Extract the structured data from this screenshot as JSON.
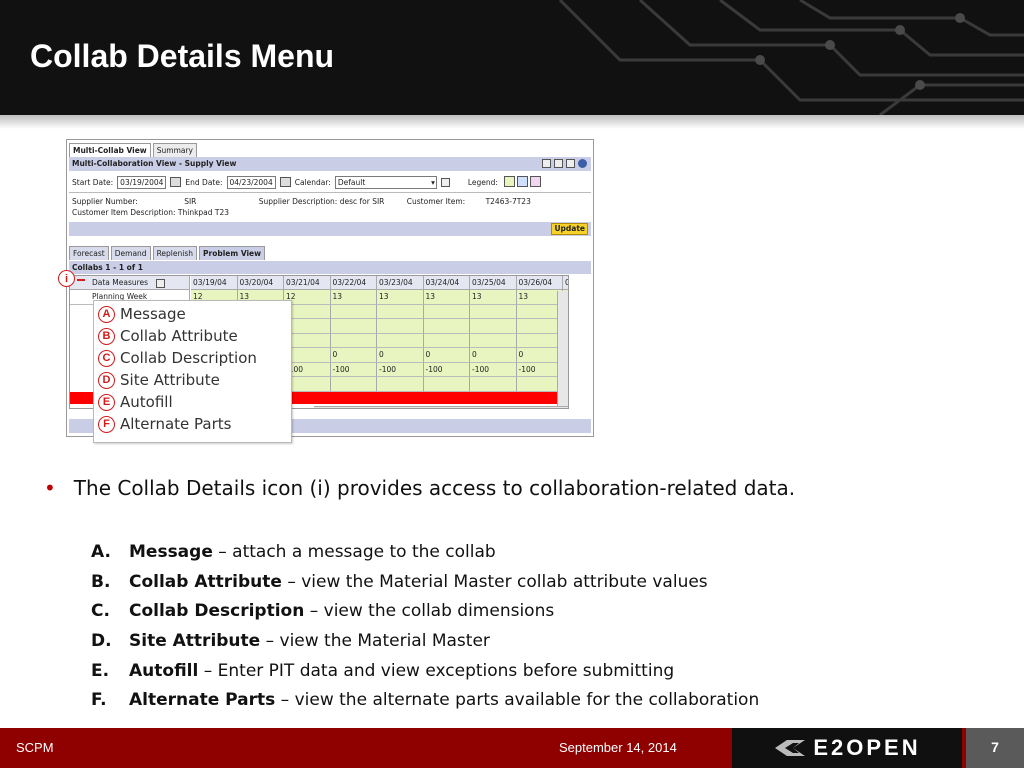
{
  "slide": {
    "title": "Collab Details Menu",
    "bullet": "The Collab Details icon (i) provides access to collaboration-related data.",
    "definitions": [
      {
        "letter": "A.",
        "term": "Message",
        "desc": " – attach a message to the collab"
      },
      {
        "letter": "B.",
        "term": "Collab Attribute",
        "desc": " – view the Material Master collab attribute values"
      },
      {
        "letter": "C.",
        "term": "Collab Description",
        "desc": " – view the collab dimensions"
      },
      {
        "letter": "D.",
        "term": "Site Attribute",
        "desc": " – view the Material Master"
      },
      {
        "letter": "E.",
        "term": "Autofill",
        "desc": " – Enter PIT data and view exceptions before submitting"
      },
      {
        "letter": "F.",
        "term": "Alternate Parts",
        "desc": " – view the alternate parts available for the collaboration"
      }
    ]
  },
  "screenshot": {
    "tabs_top": [
      "Multi-Collab View",
      "Summary"
    ],
    "view_title": "Multi-Collaboration View - Supply View",
    "start_date_label": "Start Date:",
    "start_date": "03/19/2004",
    "end_date_label": "End Date:",
    "end_date": "04/23/2004",
    "calendar_label": "Calendar:",
    "calendar_value": "Default",
    "legend_label": "Legend:",
    "supplier_number_label": "Supplier Number:",
    "supplier_number": "SIR",
    "supplier_desc_label": "Supplier Description:",
    "supplier_desc": "desc for SIR",
    "customer_item_label": "Customer Item:",
    "customer_item": "T2463-7T23",
    "customer_item_desc": "Customer Item Description: Thinkpad T23",
    "update_label": "Update",
    "tabs_view": [
      "Forecast",
      "Demand",
      "Replenish",
      "Problem View"
    ],
    "collabs_label": "Collabs 1 - 1 of 1",
    "grid": {
      "measure_header": "Data Measures",
      "first_row_label": "Planning Week",
      "dates": [
        "03/19/04",
        "03/20/04",
        "03/21/04",
        "03/22/04",
        "03/23/04",
        "03/24/04",
        "03/25/04",
        "03/26/04",
        "0"
      ],
      "row_planning": [
        "12",
        "13",
        "12",
        "13",
        "13",
        "13",
        "13",
        "13",
        "1"
      ],
      "row_zero": [
        "0",
        "0",
        "0",
        "0",
        "0",
        "0",
        "0"
      ],
      "row_neg": [
        "-100",
        "-100",
        "-100",
        "-100",
        "-100",
        "-100",
        "-:"
      ]
    },
    "marker_i": "i",
    "menu": [
      {
        "key": "A",
        "label": "Message"
      },
      {
        "key": "B",
        "label": "Collab Attribute"
      },
      {
        "key": "C",
        "label": "Collab Description"
      },
      {
        "key": "D",
        "label": "Site Attribute"
      },
      {
        "key": "E",
        "label": "Autofill"
      },
      {
        "key": "F",
        "label": "Alternate Parts"
      }
    ]
  },
  "footer": {
    "left": "SCPM",
    "date": "September 14, 2014",
    "logo": "E2OPEN",
    "page": "7"
  },
  "colors": {
    "accent_red": "#8f0000",
    "marker_red": "#d01c1c",
    "grid_green": "#e8f5c0"
  }
}
